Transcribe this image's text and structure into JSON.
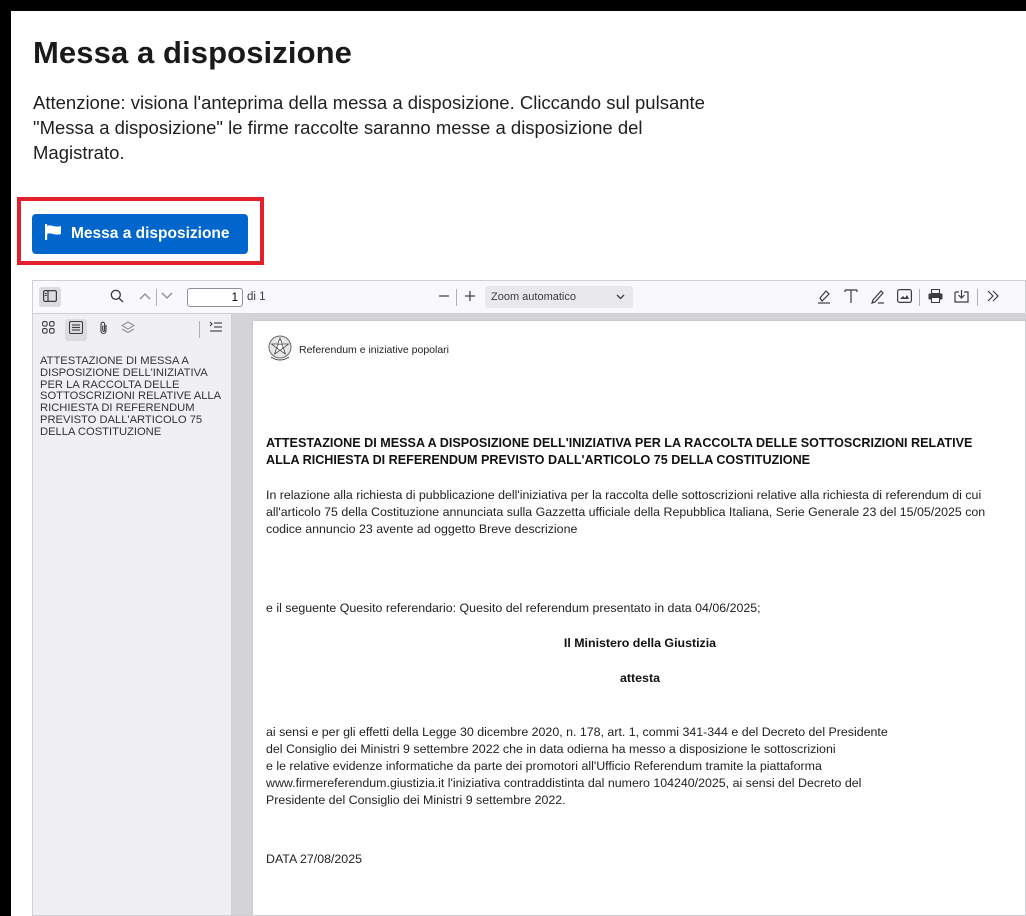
{
  "header": {
    "title": "Messa a disposizione",
    "intro": "Attenzione: visiona l'anteprima della messa a disposizione. Cliccando sul pulsante \"Messa a disposizione\" le firme raccolte saranno messe a disposizione del Magistrato."
  },
  "action": {
    "button_label": "Messa a disposizione",
    "button_icon": "flag-icon",
    "accent_color": "#0066cc",
    "highlight_color": "#e3202b"
  },
  "viewer": {
    "toolbar": {
      "page_value": "1",
      "page_total": "di 1",
      "zoom_label": "Zoom automatico"
    },
    "outline": {
      "items": [
        "ATTESTAZIONE DI MESSA A DISPOSIZIONE DELL'INIZIATIVA PER LA RACCOLTA DELLE SOTTOSCRIZIONI RELATIVE ALLA RICHIESTA DI REFERENDUM PREVISTO DALL'ARTICOLO 75 DELLA COSTITUZIONE"
      ]
    },
    "document": {
      "header_text": "Referendum e iniziative popolari",
      "title": "ATTESTAZIONE DI MESSA A DISPOSIZIONE DELL'INIZIATIVA PER LA RACCOLTA DELLE SOTTOSCRIZIONI RELATIVE ALLA RICHIESTA DI REFERENDUM PREVISTO DALL'ARTICOLO 75 DELLA COSTITUZIONE",
      "paragraph1": "In relazione alla richiesta di pubblicazione dell'iniziativa per la raccolta delle sottoscrizioni relative alla richiesta di referendum di cui all'articolo 75 della Costituzione annunciata sulla Gazzetta ufficiale della Repubblica Italiana, Serie Generale 23 del 15/05/2025 con codice annuncio 23 avente ad oggetto Breve descrizione",
      "paragraph2": "e il seguente Quesito referendario: Quesito del referendum presentato in data 04/06/2025;",
      "ministry": "Il Ministero della Giustizia",
      "attesta": "attesta",
      "paragraph3_lines": [
        "ai sensi e per gli effetti della Legge 30 dicembre 2020, n. 178, art. 1, commi 341-344 e del Decreto del Presidente",
        "del Consiglio dei Ministri 9 settembre 2022 che in data odierna ha messo a disposizione le sottoscrizioni",
        "e le relative evidenze informatiche da parte dei promotori all'Ufficio Referendum tramite la piattaforma",
        "www.firmereferendum.giustizia.it l'iniziativa contraddistinta dal numero 104240/2025, ai sensi del Decreto del",
        "Presidente del Consiglio dei Ministri 9 settembre 2022."
      ],
      "date": "DATA 27/08/2025"
    }
  }
}
